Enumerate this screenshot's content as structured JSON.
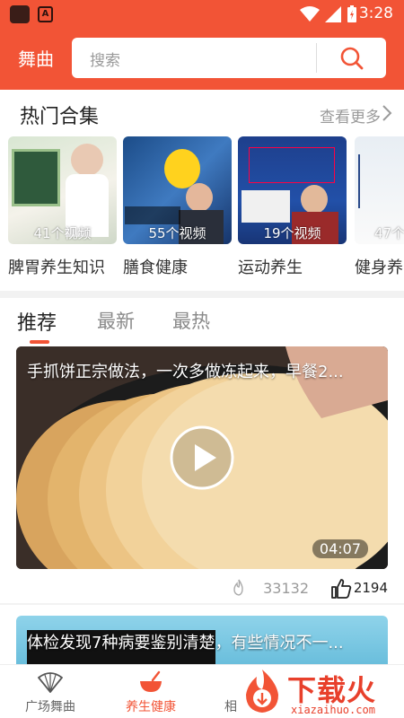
{
  "status_bar": {
    "time": "3:28"
  },
  "header": {
    "tab_label": "舞曲",
    "search_placeholder": "搜索"
  },
  "hot_collections": {
    "title": "热门合集",
    "more_label": "查看更多",
    "items": [
      {
        "label": "脾胃养生知识",
        "count": "41个视频"
      },
      {
        "label": "膳食健康",
        "count": "55个视频"
      },
      {
        "label": "运动养生",
        "count": "19个视频"
      },
      {
        "label": "健身养",
        "count": "47个"
      }
    ]
  },
  "tabs": [
    {
      "label": "推荐",
      "active": true
    },
    {
      "label": "最新",
      "active": false
    },
    {
      "label": "最热",
      "active": false
    }
  ],
  "feed": [
    {
      "title": "手抓饼正宗做法，一次多做冻起来，早餐2...",
      "duration": "04:07",
      "views": "33132",
      "likes": "2194"
    },
    {
      "title": "体检发现7种病要鉴别清楚，有些情况不一..."
    }
  ],
  "bottom_nav": [
    {
      "label": "广场舞曲",
      "icon": "fan-icon",
      "active": false
    },
    {
      "label": "养生健康",
      "icon": "bowl-icon",
      "active": true
    },
    {
      "label": "相",
      "icon": "album-icon",
      "active": false
    }
  ],
  "watermark": {
    "text": "下载火",
    "sub": "xiazaihuo.com"
  },
  "colors": {
    "brand": "#f25436",
    "white": "#ffffff"
  }
}
